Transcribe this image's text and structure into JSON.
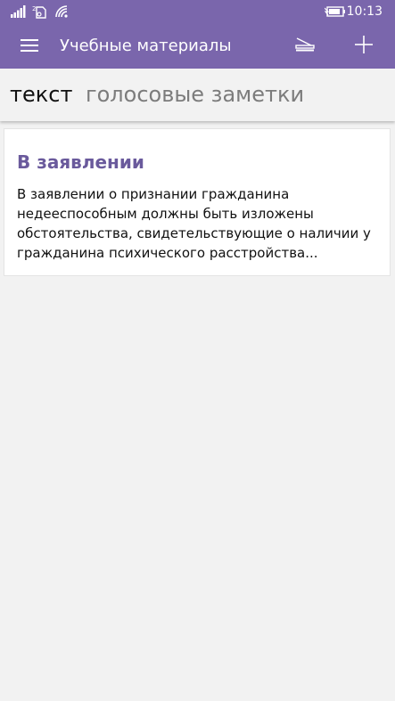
{
  "status_bar": {
    "time": "10:13",
    "signal_icon": "signal-bars-icon",
    "sim_icon": "sim-2-icon",
    "wifi_icon": "wifi-icon",
    "battery_icon": "battery-charging-icon"
  },
  "app_bar": {
    "title": "Учебные материалы",
    "menu_icon": "hamburger-menu-icon",
    "scan_icon": "scanner-icon",
    "add_icon": "plus-icon"
  },
  "tabs": [
    {
      "label": "текст",
      "active": true
    },
    {
      "label": "голосовые заметки",
      "active": false
    }
  ],
  "notes": [
    {
      "title": "В заявлении",
      "preview": "В заявлении о признании гражданина недееспособным должны быть изложены обстоятельства, свидетельствующие о наличии у гражданина психического расстройства..."
    }
  ],
  "colors": {
    "accent": "#7a66ac",
    "note_title": "#6a5a9c",
    "background": "#f2f2f2"
  }
}
